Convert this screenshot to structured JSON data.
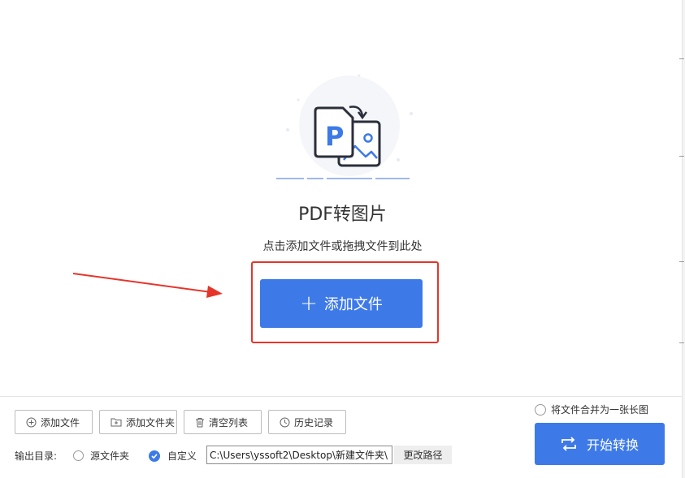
{
  "main": {
    "tool_title": "PDF转图片",
    "hint": "点击添加文件或拖拽文件到此处",
    "add_file_button": {
      "icon": "plus-icon",
      "label": "添加文件"
    },
    "illustration_icon": "pdf-to-image-icon"
  },
  "toolbar": {
    "buttons": [
      {
        "icon": "plus-circle-icon",
        "label": "添加文件"
      },
      {
        "icon": "folder-plus-icon",
        "label": "添加文件夹"
      },
      {
        "icon": "trash-icon",
        "label": "清空列表"
      },
      {
        "icon": "clock-icon",
        "label": "历史记录"
      }
    ],
    "merge_option": {
      "label": "将文件合并为一张长图",
      "checked": false
    },
    "start_button": {
      "icon": "convert-icon",
      "label": "开始转换"
    }
  },
  "output": {
    "label": "输出目录:",
    "options": [
      {
        "label": "源文件夹",
        "checked": false
      },
      {
        "label": "自定义",
        "checked": true
      }
    ],
    "path_value": "C:\\Users\\yssoft2\\Desktop\\新建文件夹\\",
    "change_path_label": "更改路径"
  },
  "colors": {
    "primary": "#3d7ae8",
    "highlight": "#e5352b"
  }
}
